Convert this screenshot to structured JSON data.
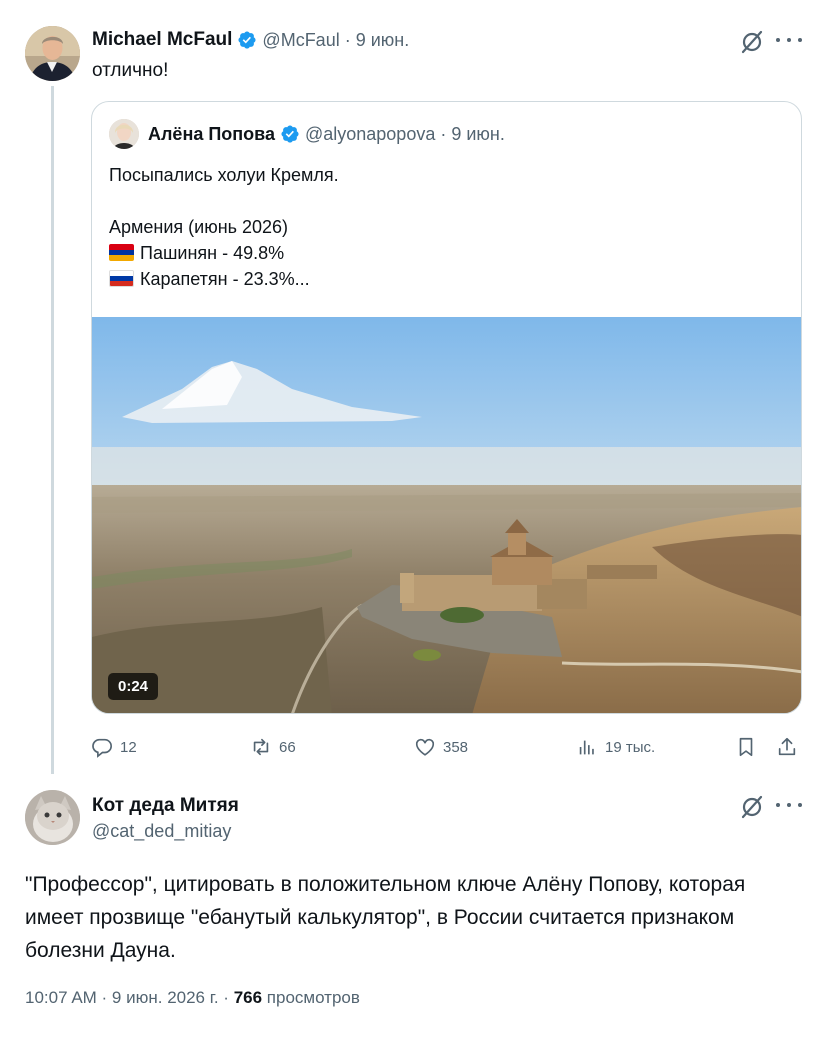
{
  "top_tweet": {
    "author_name": "Michael McFaul",
    "handle": "@McFaul",
    "date": "· 9 июн.",
    "text": "отлично!",
    "quoted": {
      "author_name": "Алёна Попова",
      "handle": "@alyonapopova",
      "date": "· 9 июн.",
      "line1": "Посыпались холуи Кремля.",
      "line2": "Армения (июнь 2026)",
      "item1": "Пашинян - 49.8%",
      "item2": "Карапетян - 23.3%...",
      "video_duration": "0:24"
    },
    "actions": {
      "replies": "12",
      "reposts": "66",
      "likes": "358",
      "views": "19 тыс."
    }
  },
  "reply_tweet": {
    "author_name": "Кот деда Митяя",
    "handle": "@cat_ded_mitiay",
    "text": "\"Профессор\", цитировать в положительном ключе Алёну Попову, которая имеет прозвище \"ебанутый калькулятор\", в России считается признаком болезни Дауна.",
    "time": "10:07 AM · 9 июн. 2026 г. · ",
    "views_count": "766",
    "views_label": " просмотров"
  },
  "colors": {
    "verified_blue": "#1d9bf0",
    "secondary_text": "#536471",
    "border": "#cfd9de",
    "armenia_flag": [
      "#d90012",
      "#0033a0",
      "#f2a800"
    ],
    "russia_flag": [
      "#ffffff",
      "#0039a6",
      "#d52b1e"
    ]
  },
  "icons": [
    "grok-icon",
    "more-icon",
    "verified-icon",
    "reply-icon",
    "repost-icon",
    "like-icon",
    "views-icon",
    "bookmark-icon",
    "share-icon"
  ]
}
